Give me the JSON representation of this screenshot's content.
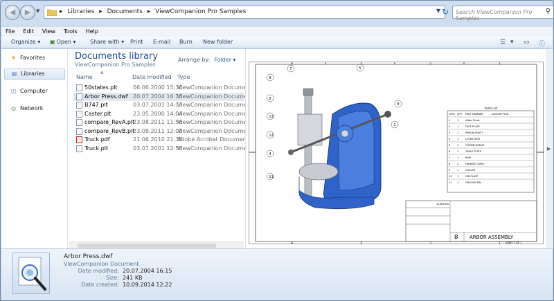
{
  "address": {
    "crumbs": [
      "Libraries",
      "Documents",
      "ViewCompanion Pro Samples"
    ],
    "search_placeholder": "Search ViewCompanion Pro Samples"
  },
  "menu": [
    "File",
    "Edit",
    "View",
    "Tools",
    "Help"
  ],
  "commands": {
    "organize": "Organize",
    "open": "Open",
    "share": "Share with",
    "print": "Print",
    "email": "E-mail",
    "burn": "Burn",
    "new_folder": "New folder"
  },
  "sidebar": {
    "favorites": "Favorites",
    "libraries": "Libraries",
    "computer": "Computer",
    "network": "Network"
  },
  "library": {
    "title": "Documents library",
    "subtitle": "ViewCompanion Pro Samples",
    "arrange_label": "Arrange by:",
    "arrange_value": "Folder"
  },
  "columns": {
    "name": "Name",
    "date": "Date modified",
    "type": "Type"
  },
  "files": [
    {
      "name": "50states.plt",
      "date": "06.06.2000 15:36",
      "type": "ViewCompanion Document",
      "icon": "document-icon"
    },
    {
      "name": "Arbor Press.dwf",
      "date": "20.07.2004 16:15",
      "type": "ViewCompanion Document",
      "icon": "document-icon"
    },
    {
      "name": "B747.plt",
      "date": "03.07.2001 14:13",
      "type": "ViewCompanion Document",
      "icon": "document-icon"
    },
    {
      "name": "Caster.plt",
      "date": "23.05.2000 14:04",
      "type": "ViewCompanion Document",
      "icon": "document-icon"
    },
    {
      "name": "compare_RevA.plt",
      "date": "23.08.2011 11:58",
      "type": "ViewCompanion Document",
      "icon": "document-icon"
    },
    {
      "name": "compare_RevB.plt",
      "date": "23.08.2011 12:08",
      "type": "ViewCompanion Document",
      "icon": "document-icon"
    },
    {
      "name": "Truck.pdf",
      "date": "21.06.2010 21:38",
      "type": "Adobe Acrobat Document",
      "icon": "pdf-icon"
    },
    {
      "name": "Truck.plt",
      "date": "03.07.2001 12:55",
      "type": "ViewCompanion Document",
      "icon": "document-icon"
    }
  ],
  "details": {
    "name": "Arbor Press.dwf",
    "type": "ViewCompanion Document",
    "modified_label": "Date modified:",
    "modified": "20.07.2004 16:15",
    "size_label": "Size:",
    "size": "241 KB",
    "created_label": "Date created:",
    "created": "10.09.2014 12:22"
  },
  "drawing": {
    "parts_title": "Parts List",
    "parts_headers": [
      "ITEM",
      "QTY",
      "PART NUMBER",
      "DESCRIPTION"
    ],
    "parts": [
      [
        "1",
        "1",
        "Arbor Press",
        ""
      ],
      [
        "2",
        "1",
        "FACE PLATE",
        ""
      ],
      [
        "3",
        "1",
        "PINION SHAFT",
        ""
      ],
      [
        "4",
        "1",
        "LEVER ARM",
        ""
      ],
      [
        "5",
        "1",
        "THUMB SCREW",
        ""
      ],
      [
        "6",
        "1",
        "TABLE PLATE",
        ""
      ],
      [
        "7",
        "1",
        "RAM",
        ""
      ],
      [
        "8",
        "2",
        "HANDLE CAPpt",
        ""
      ],
      [
        "9",
        "1",
        "COLLAR",
        ""
      ],
      [
        "10",
        "1",
        "GIB PLATE",
        ""
      ],
      [
        "11",
        "1",
        "GROOVE PIN",
        ""
      ]
    ],
    "title_text": "ARBOR ASSEMBLY",
    "date": "12/8/2000",
    "size_code": "B",
    "sheet": "SHEET 1 OF 1",
    "balloons": [
      "7",
      "9",
      "5",
      "8",
      "3",
      "13",
      "12",
      "1",
      "4",
      "11"
    ],
    "col_labels": [
      "4",
      "3",
      "2",
      "1"
    ]
  }
}
